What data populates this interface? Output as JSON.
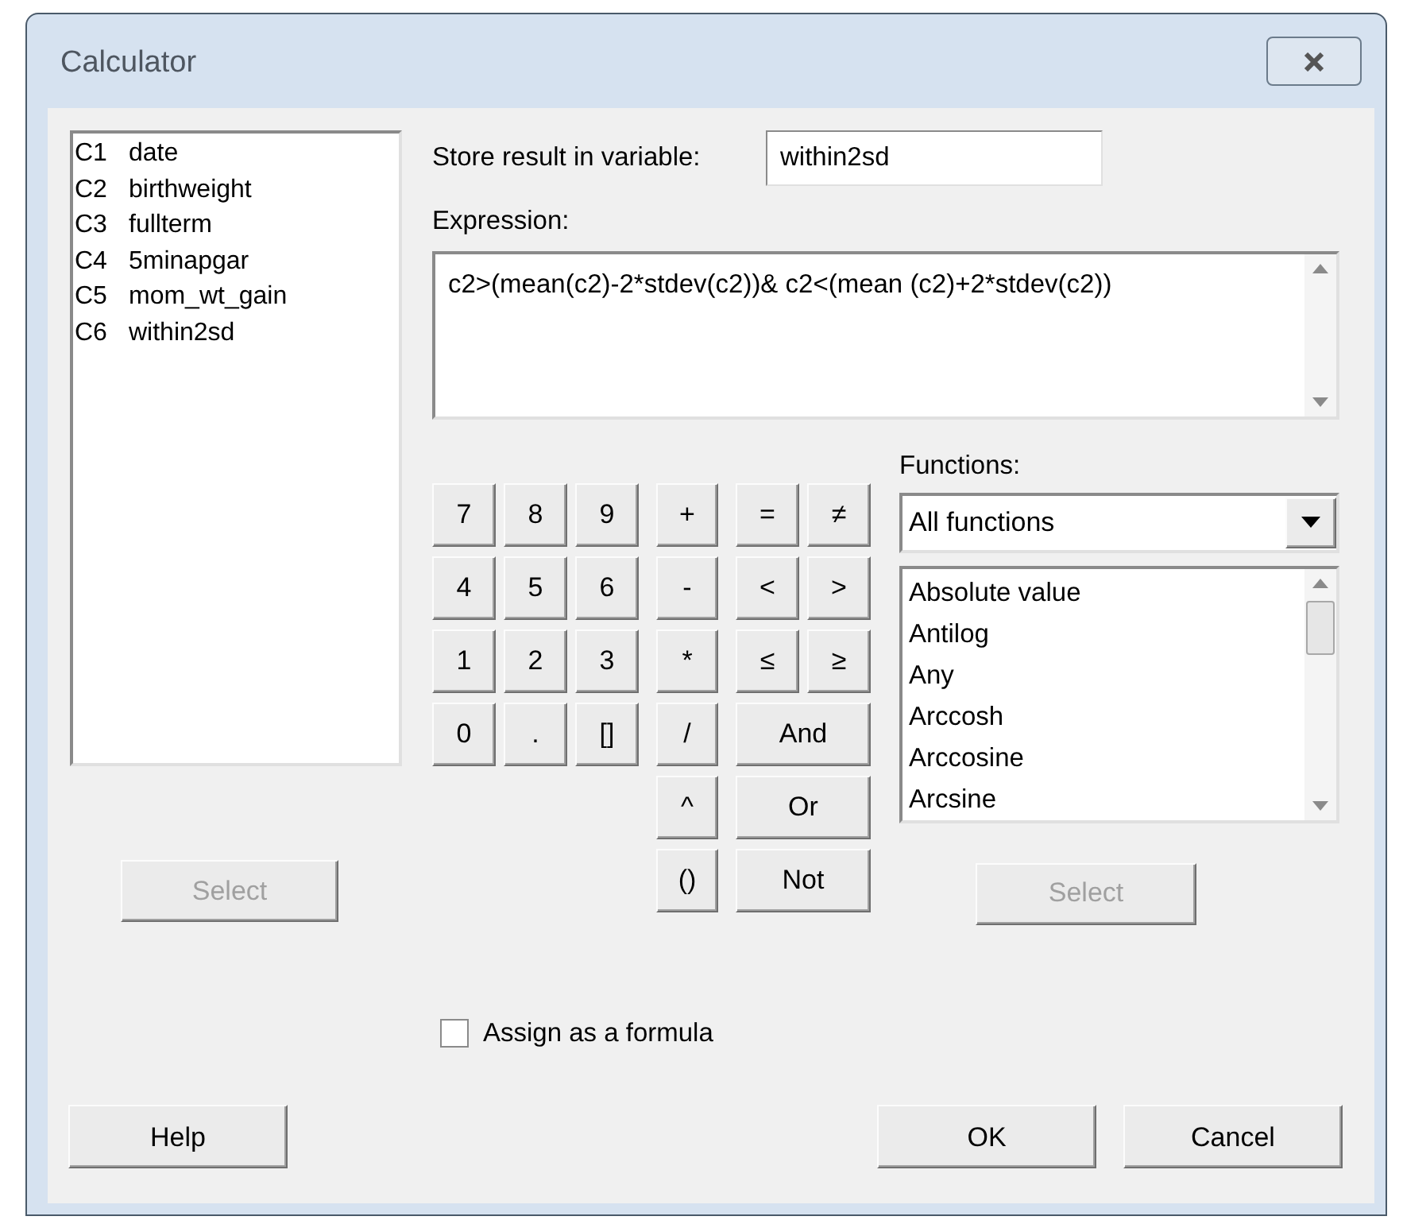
{
  "window": {
    "title": "Calculator"
  },
  "columns": {
    "items": [
      {
        "code": "C1",
        "name": "date"
      },
      {
        "code": "C2",
        "name": "birthweight"
      },
      {
        "code": "C3",
        "name": "fullterm"
      },
      {
        "code": "C4",
        "name": "5minapgar"
      },
      {
        "code": "C5",
        "name": "mom_wt_gain"
      },
      {
        "code": "C6",
        "name": "within2sd"
      }
    ],
    "select_button": {
      "label": "Select",
      "disabled": true
    }
  },
  "store": {
    "label": "Store result in variable:",
    "value": "within2sd"
  },
  "expression": {
    "label": "Expression:",
    "value": "c2>(mean(c2)-2*stdev(c2))& c2<(mean (c2)+2*stdev(c2))"
  },
  "keypad": {
    "digit_keys": [
      "7",
      "8",
      "9",
      "4",
      "5",
      "6",
      "1",
      "2",
      "3",
      "0",
      ".",
      "[]"
    ],
    "operator_keys": [
      "+",
      "-",
      "*",
      "/",
      "^",
      "()"
    ],
    "comparison_keys": [
      "=",
      "≠",
      "<",
      ">",
      "≤",
      "≥"
    ],
    "logic_keys": [
      "And",
      "Or",
      "Not"
    ]
  },
  "functions": {
    "label": "Functions:",
    "category": "All functions",
    "items": [
      "Absolute value",
      "Antilog",
      "Any",
      "Arccosh",
      "Arccosine",
      "Arcsine"
    ],
    "select_button": {
      "label": "Select",
      "disabled": true
    }
  },
  "assign_formula": {
    "label": "Assign as a formula",
    "checked": false
  },
  "buttons": [
    {
      "label": "Help",
      "kind": "left"
    },
    {
      "label": "OK",
      "kind": "right"
    },
    {
      "label": "Cancel",
      "kind": "right"
    }
  ]
}
